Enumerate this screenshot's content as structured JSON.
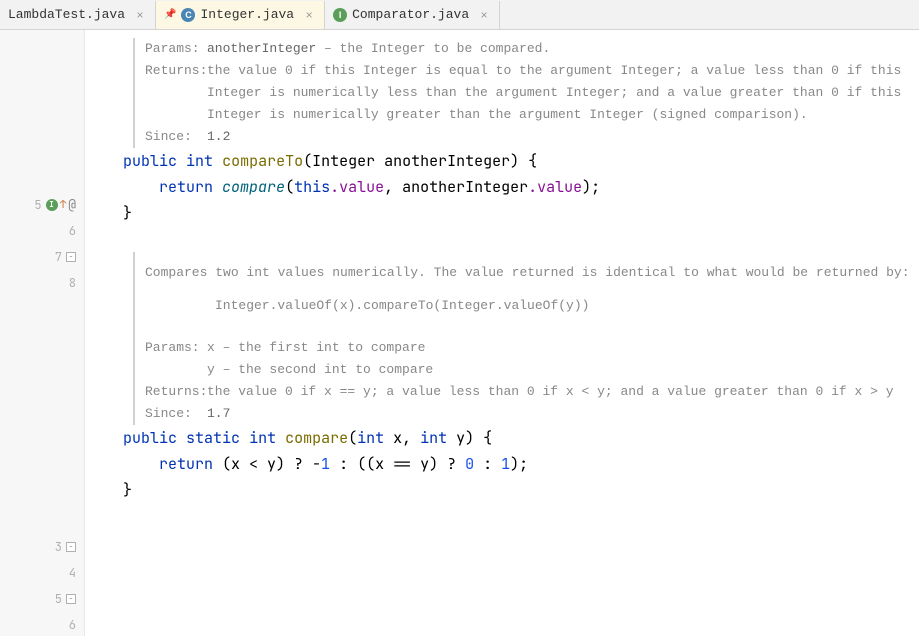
{
  "tabs": [
    {
      "label": "LambdaTest.java",
      "icon": null
    },
    {
      "label": "Integer.java",
      "icon": "C"
    },
    {
      "label": "Comparator.java",
      "icon": "I"
    }
  ],
  "javadoc1": {
    "params_label": "Params:",
    "param_name": "anotherInteger",
    "param_sep": " – ",
    "param_desc": "the Integer to be compared.",
    "returns_label": "Returns:",
    "returns_text": "the value 0 if this Integer is equal to the argument Integer; a value less than 0 if this Integer is numerically less than the argument Integer; and a value greater than 0 if this Integer is numerically greater than the argument Integer (signed comparison).",
    "since_label": "Since:",
    "since_val": "1.2"
  },
  "method1": {
    "sig_p1": "public",
    "sig_p2": "int",
    "sig_name": "compareTo",
    "sig_args": "(Integer anotherInteger) {",
    "body_kw": "return",
    "body_call": "compare",
    "body_this": "this",
    "body_fld1": ".value",
    "body_mid": ", anotherInteger",
    "body_fld2": ".value",
    "body_end": ");",
    "close": "}"
  },
  "javadoc2": {
    "summary": "Compares two int values numerically. The value returned is identical to what would be returned by:",
    "example": "Integer.valueOf(x).compareTo(Integer.valueOf(y))",
    "params_label": "Params:",
    "param_x": "x – the first int to compare",
    "param_y": "y – the second int to compare",
    "returns_label": "Returns:",
    "returns_text": "the value 0 if x == y; a value less than 0 if x < y; and a value greater than 0 if x > y",
    "since_label": "Since:",
    "since_val": "1.7"
  },
  "method2": {
    "sig_p1": "public",
    "sig_p2": "static",
    "sig_p3": "int",
    "sig_name": "compare",
    "sig_args": "(",
    "sig_int1": "int",
    "sig_x": " x, ",
    "sig_int2": "int",
    "sig_y": " y) {",
    "body_kw": "return",
    "body_expr1": " (x < y) ? -",
    "body_n1": "1",
    "body_expr2": " : ((x == y) ? ",
    "body_n0": "0",
    "body_expr3": " : ",
    "body_n1b": "1",
    "body_expr4": ");",
    "close": "}"
  },
  "line_numbers": {
    "l5": "5",
    "l6": "6",
    "l7": "7",
    "l8": "8",
    "l3": "3",
    "l4": "4",
    "l5b": "5",
    "l6b": "6"
  }
}
